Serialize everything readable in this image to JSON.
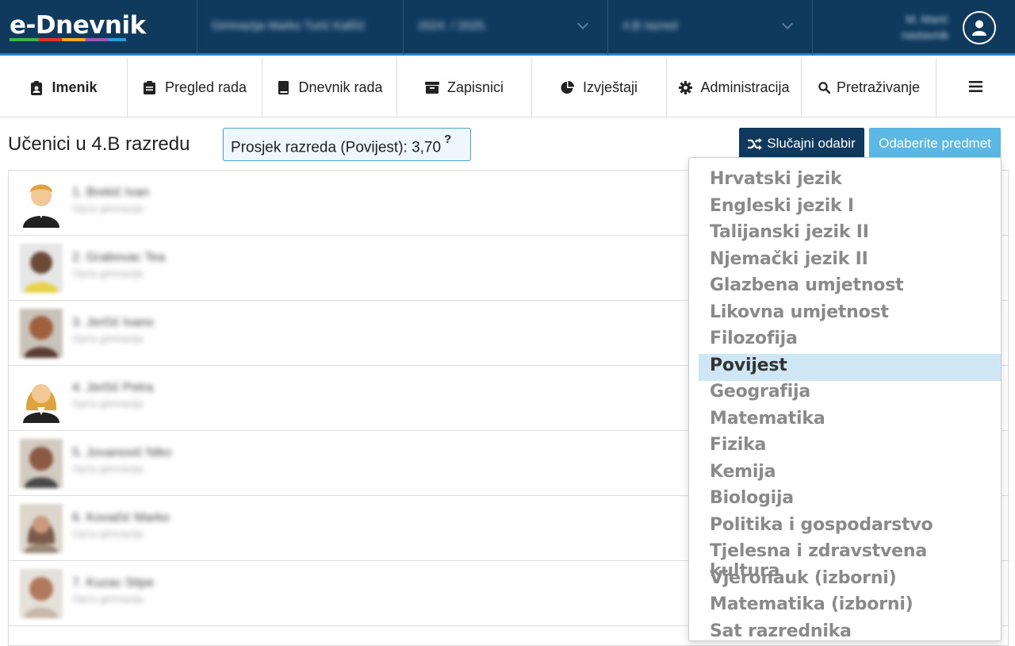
{
  "app": {
    "logo": "e-Dnevnik"
  },
  "topbar": {
    "school": "Gimnazija Marko Turić Kalčić",
    "year": "2024. / 2025.",
    "class": "4.B razred",
    "user_name": "M. Marić",
    "user_role": "nastavnik"
  },
  "nav": {
    "tabs": [
      {
        "label": "Imenik",
        "icon": "id-badge-icon"
      },
      {
        "label": "Pregled rada",
        "icon": "clipboard-icon"
      },
      {
        "label": "Dnevnik rada",
        "icon": "book-icon"
      },
      {
        "label": "Zapisnici",
        "icon": "archive-icon"
      },
      {
        "label": "Izvještaji",
        "icon": "pie-chart-icon"
      },
      {
        "label": "Administracija",
        "icon": "gear-icon"
      },
      {
        "label": "Pretraživanje",
        "icon": "search-icon"
      }
    ],
    "menu_icon": "hamburger-icon"
  },
  "main": {
    "title": "Učenici u 4.B razredu",
    "average_label": "Prosjek razreda (Povijest): 3,70",
    "average_help": "?",
    "random_button": "Slučajni odabir",
    "subject_button": "Odaberite predmet"
  },
  "students": [
    {
      "name": "1. Brekić Ivan",
      "school": "Opća gimnazija"
    },
    {
      "name": "2. Grabovac Tea",
      "school": "Opća gimnazija"
    },
    {
      "name": "3. Jerčić Ivano",
      "school": "Opća gimnazija"
    },
    {
      "name": "4. Jerčić Petra",
      "school": "Opća gimnazija"
    },
    {
      "name": "5. Jovanović Niko",
      "school": "Opća gimnazija"
    },
    {
      "name": "6. Kovačić Marko",
      "school": "Opća gimnazija"
    },
    {
      "name": "7. Kuzac Stipe",
      "school": "Opća gimnazija"
    }
  ],
  "subjects": {
    "selected": "Povijest",
    "items": [
      "Hrvatski jezik",
      "Engleski jezik I",
      "Talijanski jezik II",
      "Njemački jezik II",
      "Glazbena umjetnost",
      "Likovna umjetnost",
      "Filozofija",
      "Povijest",
      "Geografija",
      "Matematika",
      "Fizika",
      "Kemija",
      "Biologija",
      "Politika i gospodarstvo",
      "Tjelesna i zdravstvena kultura",
      "Vjeronauk (izborni)",
      "Matematika (izborni)",
      "Sat razrednika"
    ]
  },
  "colors": {
    "header_bg": "#0f3a5e",
    "accent": "#2a7fc4",
    "random_button_bg": "#0f3a5e",
    "subject_button_bg": "#5bb7e4",
    "selected_item_bg": "#cfe6f5"
  }
}
